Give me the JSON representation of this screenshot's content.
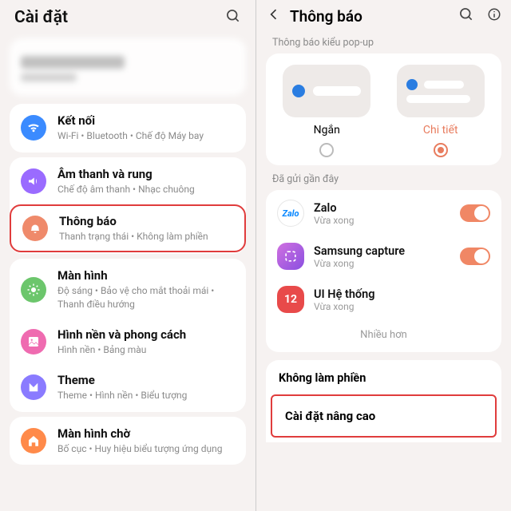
{
  "left": {
    "header": {
      "title": "Cài đặt"
    },
    "groups": [
      {
        "rows": [
          {
            "icon": "wifi",
            "color": "#3b8bff",
            "title": "Kết nối",
            "sub": "Wi-Fi  •  Bluetooth  •  Chế độ Máy bay"
          }
        ]
      },
      {
        "rows": [
          {
            "icon": "sound",
            "color": "#9a6bff",
            "title": "Âm thanh và rung",
            "sub": "Chế độ âm thanh  •  Nhạc chuông"
          },
          {
            "icon": "notif",
            "color": "#ef8a6b",
            "title": "Thông báo",
            "sub": "Thanh trạng thái  •  Không làm phiền",
            "hl": true
          }
        ]
      },
      {
        "rows": [
          {
            "icon": "display",
            "color": "#6cc66c",
            "title": "Màn hình",
            "sub": "Độ sáng  •  Bảo vệ cho mắt thoải mái  •  Thanh điều hướng"
          },
          {
            "icon": "wallpaper",
            "color": "#ef6bb0",
            "title": "Hình nền và phong cách",
            "sub": "Hình nền  •  Bảng màu"
          },
          {
            "icon": "theme",
            "color": "#8a7bff",
            "title": "Theme",
            "sub": "Theme  •  Hình nền  •  Biểu tượng"
          }
        ]
      },
      {
        "rows": [
          {
            "icon": "home",
            "color": "#ff8a4a",
            "title": "Màn hình chờ",
            "sub": "Bố cục  •  Huy hiệu biểu tượng ứng dụng"
          }
        ]
      }
    ]
  },
  "right": {
    "header": {
      "title": "Thông báo"
    },
    "popup_section": "Thông báo kiểu pop-up",
    "popup": {
      "brief": "Ngắn",
      "detail": "Chi tiết"
    },
    "recent_section": "Đã gửi gần đây",
    "recent": [
      {
        "name": "Zalo",
        "sub": "Vừa xong",
        "ico": "zalo"
      },
      {
        "name": "Samsung capture",
        "sub": "Vừa xong",
        "ico": "samsung"
      },
      {
        "name": "UI Hệ thống",
        "sub": "Vừa xong",
        "ico": "uisys",
        "no_toggle": true
      }
    ],
    "more": "Nhiều hơn",
    "dnd": "Không làm phiền",
    "advanced": "Cài đặt nâng cao"
  }
}
